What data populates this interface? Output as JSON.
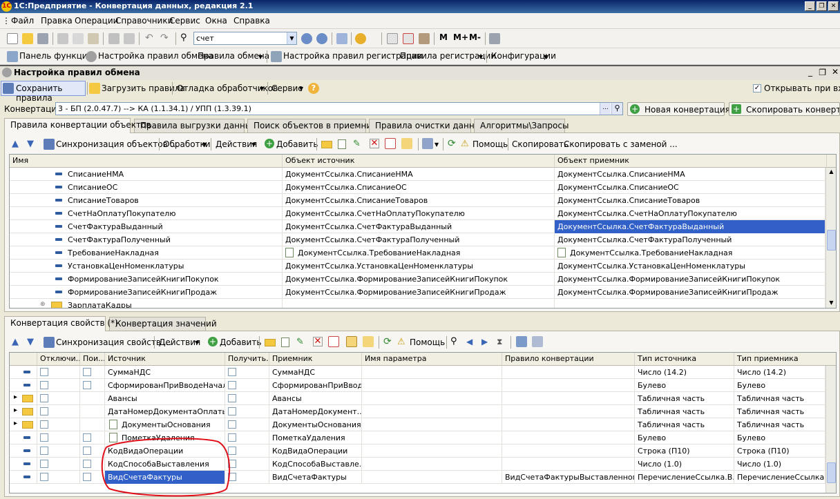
{
  "window": {
    "title": "1С:Предприятие - Конвертация данных, редакция 2.1",
    "logo_text": "1С"
  },
  "menu": [
    "Файл",
    "Правка",
    "Операции",
    "Справочники",
    "Сервис",
    "Окна",
    "Справка"
  ],
  "toolbar": {
    "search_value": "счет",
    "m_buttons": [
      "M",
      "M+",
      "M-"
    ]
  },
  "panel_bar": {
    "items": [
      "Панель функций",
      "Настройка правил обмена",
      "Правила обмена",
      "Настройка правил регистрации",
      "Правила регистрации",
      "Конфигурации"
    ]
  },
  "form": {
    "title": "Настройка правил обмена",
    "save_label": "Сохранить правила",
    "load_label": "Загрузить правила",
    "debug_label": "Отладка обработчиков",
    "service_label": "Сервис",
    "open_on_enter_label": "Открывать при входе",
    "conversion_label": "Конвертация:",
    "conversion_value": "3 - БП (2.0.47.7) --> КА (1.1.34.1) / УПП (1.3.39.1)",
    "new_conversion_label": "Новая конвертация ...",
    "copy_conversion_label": "Скопировать конвертацию"
  },
  "top_tabs": [
    "Правила конвертации объектов",
    "Правила выгрузки данных",
    "Поиск объектов в приемнике",
    "Правила очистки данных",
    "Алгоритмы\\Запросы"
  ],
  "top_toolbar": {
    "sync_label": "Синхронизация объектов ...",
    "processing_label": "Обработки",
    "actions_label": "Действия",
    "add_label": "Добавить",
    "help_label": "Помощь",
    "copy_label": "Скопировать",
    "copy_replace_label": "Скопировать с заменой ..."
  },
  "object_grid": {
    "columns": [
      "Имя",
      "Объект источник",
      "Объект приемник"
    ],
    "rows": [
      {
        "name": "СписаниеНМА",
        "source": "ДокументСсылка.СписаниеНМА",
        "target": "ДокументСсылка.СписаниеНМА"
      },
      {
        "name": "СписаниеОС",
        "source": "ДокументСсылка.СписаниеОС",
        "target": "ДокументСсылка.СписаниеОС"
      },
      {
        "name": "СписаниеТоваров",
        "source": "ДокументСсылка.СписаниеТоваров",
        "target": "ДокументСсылка.СписаниеТоваров"
      },
      {
        "name": "СчетНаОплатуПокупателю",
        "source": "ДокументСсылка.СчетНаОплатуПокупателю",
        "target": "ДокументСсылка.СчетНаОплатуПокупателю"
      },
      {
        "name": "СчетФактураВыданный",
        "source": "ДокументСсылка.СчетФактураВыданный",
        "target": "ДокументСсылка.СчетФактураВыданный"
      },
      {
        "name": "СчетФактураПолученный",
        "source": "ДокументСсылка.СчетФактураПолученный",
        "target": "ДокументСсылка.СчетФактураПолученный"
      },
      {
        "name": "ТребованиеНакладная",
        "source": "ДокументСсылка.ТребованиеНакладная",
        "target": "ДокументСсылка.ТребованиеНакладная"
      },
      {
        "name": "УстановкаЦенНоменклатуры",
        "source": "ДокументСсылка.УстановкаЦенНоменклатуры",
        "target": "ДокументСсылка.УстановкаЦенНоменклатуры"
      },
      {
        "name": "ФормированиеЗаписейКнигиПокупок",
        "source": "ДокументСсылка.ФормированиеЗаписейКнигиПокупок",
        "target": "ДокументСсылка.ФормированиеЗаписейКнигиПокупок"
      },
      {
        "name": "ФормированиеЗаписейКнигиПродаж",
        "source": "ДокументСсылка.ФормированиеЗаписейКнигиПродаж",
        "target": "ДокументСсылка.ФормированиеЗаписейКнигиПродаж"
      },
      {
        "name": "ЗарплатаКадры",
        "source": "",
        "target": ""
      }
    ]
  },
  "bottom_tabs": [
    "Конвертация свойств (*)",
    "Конвертация значений"
  ],
  "bottom_toolbar": {
    "sync_label": "Синхронизация свойств ...",
    "actions_label": "Действия",
    "add_label": "Добавить",
    "help_label": "Помощь"
  },
  "props_grid": {
    "columns": [
      "Отключи...",
      "Пои...",
      "Источник",
      "Получить...",
      "Приемник",
      "Имя параметра",
      "Правило конвертации",
      "Тип источника",
      "Тип приемника"
    ],
    "rows": [
      {
        "source": "СуммаНДС",
        "target": "СуммаНДС",
        "param": "",
        "rule": "",
        "src_type": "Число (14.2)",
        "dst_type": "Число (14.2)"
      },
      {
        "source": "СформированПриВводеНачал...",
        "target": "СформированПриВвод...",
        "param": "",
        "rule": "",
        "src_type": "Булево",
        "dst_type": "Булево"
      },
      {
        "source": "Авансы",
        "target": "Авансы",
        "param": "",
        "rule": "",
        "src_type": "Табличная часть",
        "dst_type": "Табличная часть"
      },
      {
        "source": "ДатаНомерДокументаОплаты",
        "target": "ДатаНомерДокумент...",
        "param": "",
        "rule": "",
        "src_type": "Табличная часть",
        "dst_type": "Табличная часть"
      },
      {
        "source": "ДокументыОснования",
        "target": "ДокументыОснования",
        "param": "",
        "rule": "",
        "src_type": "Табличная часть",
        "dst_type": "Табличная часть"
      },
      {
        "source": "ПометкаУдаления",
        "target": "ПометкаУдаления",
        "param": "",
        "rule": "",
        "src_type": "Булево",
        "dst_type": "Булево"
      },
      {
        "source": "КодВидаОперации",
        "target": "КодВидаОперации",
        "param": "",
        "rule": "",
        "src_type": "Строка (П10)",
        "dst_type": "Строка (П10)"
      },
      {
        "source": "КодСпособаВыставления",
        "target": "КодСпособаВыставле...",
        "param": "",
        "rule": "",
        "src_type": "Число (1.0)",
        "dst_type": "Число (1.0)"
      },
      {
        "source": "ВидСчетаФактуры",
        "target": "ВидСчетаФактуры",
        "param": "",
        "rule": "ВидСчетаФактурыВыставленного",
        "src_type": "ПеречислениеСсылка.В...",
        "dst_type": "ПеречислениеСсылка...."
      }
    ]
  },
  "colors": {
    "selection": "#3160C8",
    "highlight_circle": "#E0101A",
    "title_bar": "#0A246A"
  }
}
